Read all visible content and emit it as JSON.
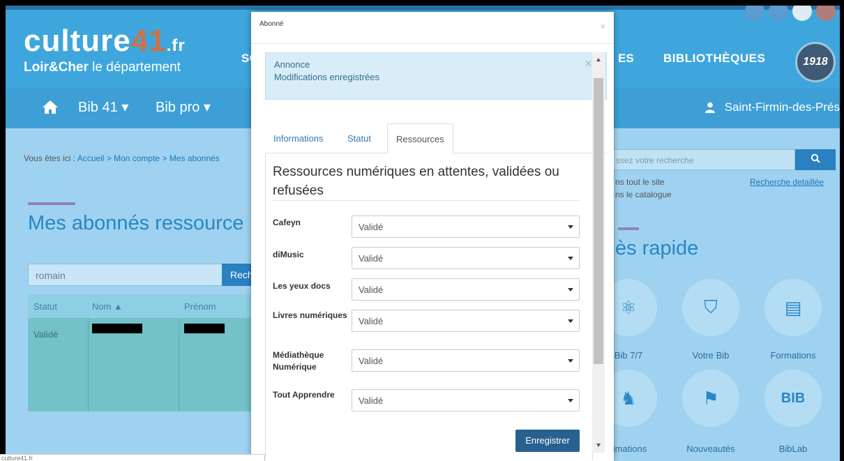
{
  "background": {
    "logo": {
      "name": "culture",
      "number": "41",
      "tld": ".fr",
      "sub_bold": "Loir&Cher",
      "sub_rest": " le département"
    },
    "menu": {
      "partial_left": "SO",
      "partial_right": "ES",
      "bibliotheques": "BIBLIOTHÈQUES"
    },
    "seal_text": "1918",
    "nav": {
      "home_icon": "home-icon",
      "item1": "Bib 41 ▾",
      "item2": "Bib pro ▾",
      "user": "Saint-Firmin-des-Prés"
    },
    "breadcrumb": {
      "prefix": "Vous êtes ici : ",
      "path": "Accueil > Mon compte > Mes abonnés"
    },
    "page_title": "Mes abonnés ressource",
    "search": {
      "value": "romain",
      "button": "Rech"
    },
    "table": {
      "headers": [
        "Statut",
        "Nom ▲",
        "Prénom"
      ],
      "row": {
        "statut": "Validé"
      }
    },
    "right": {
      "search_placeholder": "ssez votre recherche",
      "scope1": "ns tout le site",
      "scope2": "ns le catalogue",
      "advanced": "Recherche detaillée",
      "quick_title": "ès rapide",
      "tiles": [
        {
          "label": "Bib 7/7",
          "icon": "atom-icon"
        },
        {
          "label": "Votre Bib",
          "icon": "map-icon"
        },
        {
          "label": "Formations",
          "icon": "briefcase-icon"
        },
        {
          "label": "imations",
          "icon": "knight-icon"
        },
        {
          "label": "Nouveautés",
          "icon": "flag-icon"
        },
        {
          "label": "BibLab",
          "icon": "biblab-icon"
        }
      ]
    }
  },
  "modal": {
    "title": "Abonné",
    "close": "×",
    "alert": {
      "title": "Annonce",
      "message": "Modifications enregistrées",
      "close": "×"
    },
    "tabs": [
      "Informations",
      "Statut",
      "Ressources"
    ],
    "active_tab": "Ressources",
    "panel_title": "Ressources numériques en attentes, validées ou refusées",
    "resources": [
      {
        "label": "Cafeyn",
        "value": "Validé"
      },
      {
        "label": "diMusic",
        "value": "Validé"
      },
      {
        "label": "Les yeux docs",
        "value": "Validé"
      },
      {
        "label": "Livres numériques",
        "value": "Validé"
      },
      {
        "label": "Médiathèque Numérique",
        "value": "Validé"
      },
      {
        "label": "Tout Apprendre",
        "value": "Validé"
      }
    ],
    "save": "Enregistrer"
  },
  "statusbar": "culture41.fr"
}
